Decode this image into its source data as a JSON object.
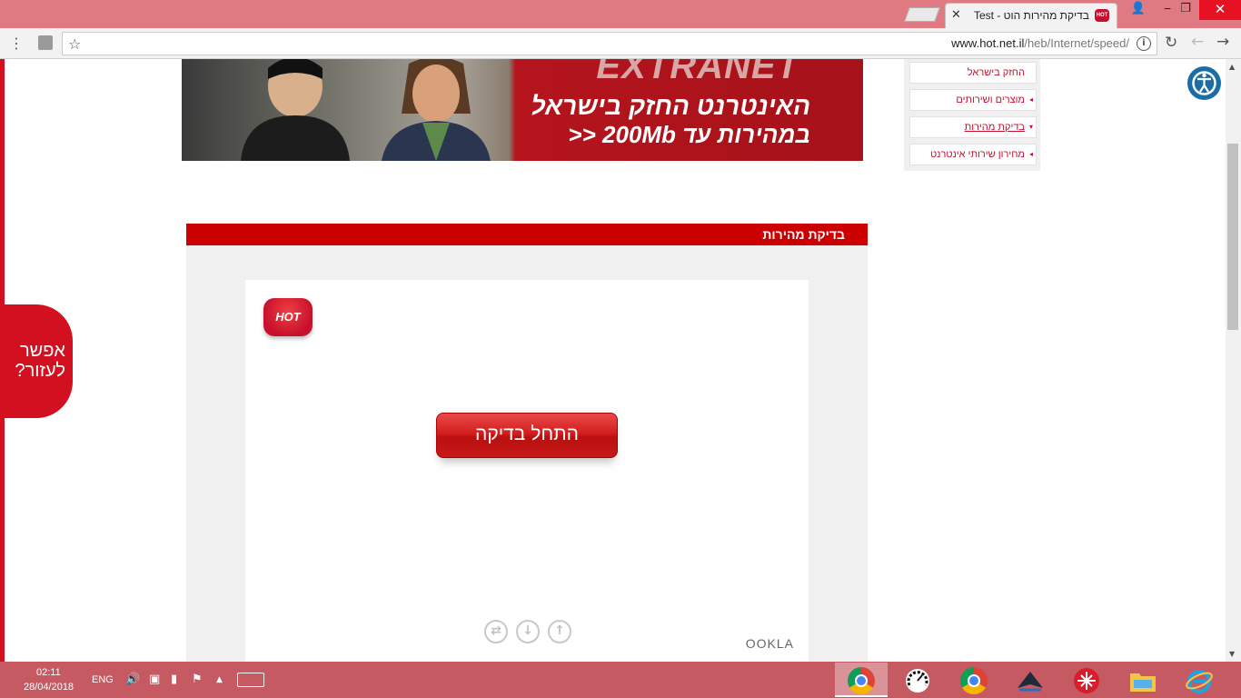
{
  "browser": {
    "tab_title": "בדיקת מהירות הוט - Test",
    "tab_favicon_text": "HOT",
    "url_domain": "www.hot.net.il",
    "url_path": "/heb/Internet/speed/",
    "close_glyph": "✕",
    "window_controls": {
      "user": "👤",
      "minimize": "‒",
      "maximize": "❐",
      "close": "✕"
    },
    "icons": {
      "menu": "⋮",
      "star": "☆",
      "info": "i",
      "reload": "↻",
      "back": "←",
      "forward": "→"
    }
  },
  "banner": {
    "brand": "EXTRANET",
    "line1": "האינטרנט החזק בישראל",
    "line2": "במהירות עד 200Mb <<"
  },
  "side_menu": {
    "items": [
      {
        "label": "החזק בישראל",
        "arrow": ""
      },
      {
        "label": "מוצרים ושירותים",
        "arrow": "◂"
      },
      {
        "label": "בדיקת מהירות",
        "arrow": "▾"
      },
      {
        "label": "מחירון שירותי אינטרנט",
        "arrow": "◂"
      }
    ]
  },
  "help_tab": {
    "line1": "אפשר",
    "line2": "לעזור?"
  },
  "speed_test": {
    "header_title": "בדיקת מהירות",
    "logo_text": "HOT",
    "start_button": "התחל בדיקה",
    "controls": {
      "ping": "⇄",
      "download": "↓",
      "upload": "↑"
    },
    "ookla": "OOKLA"
  },
  "taskbar": {
    "time": "02:11",
    "date": "28/04/2018",
    "language": "ENG",
    "tray": {
      "volume": "🔊",
      "network": "▣",
      "battery": "▮",
      "flag": "⚑",
      "chevron": "▲"
    }
  },
  "colors": {
    "hot_red": "#c8102e",
    "panel_header": "#cc0000",
    "chrome_frame": "#e07a82"
  }
}
